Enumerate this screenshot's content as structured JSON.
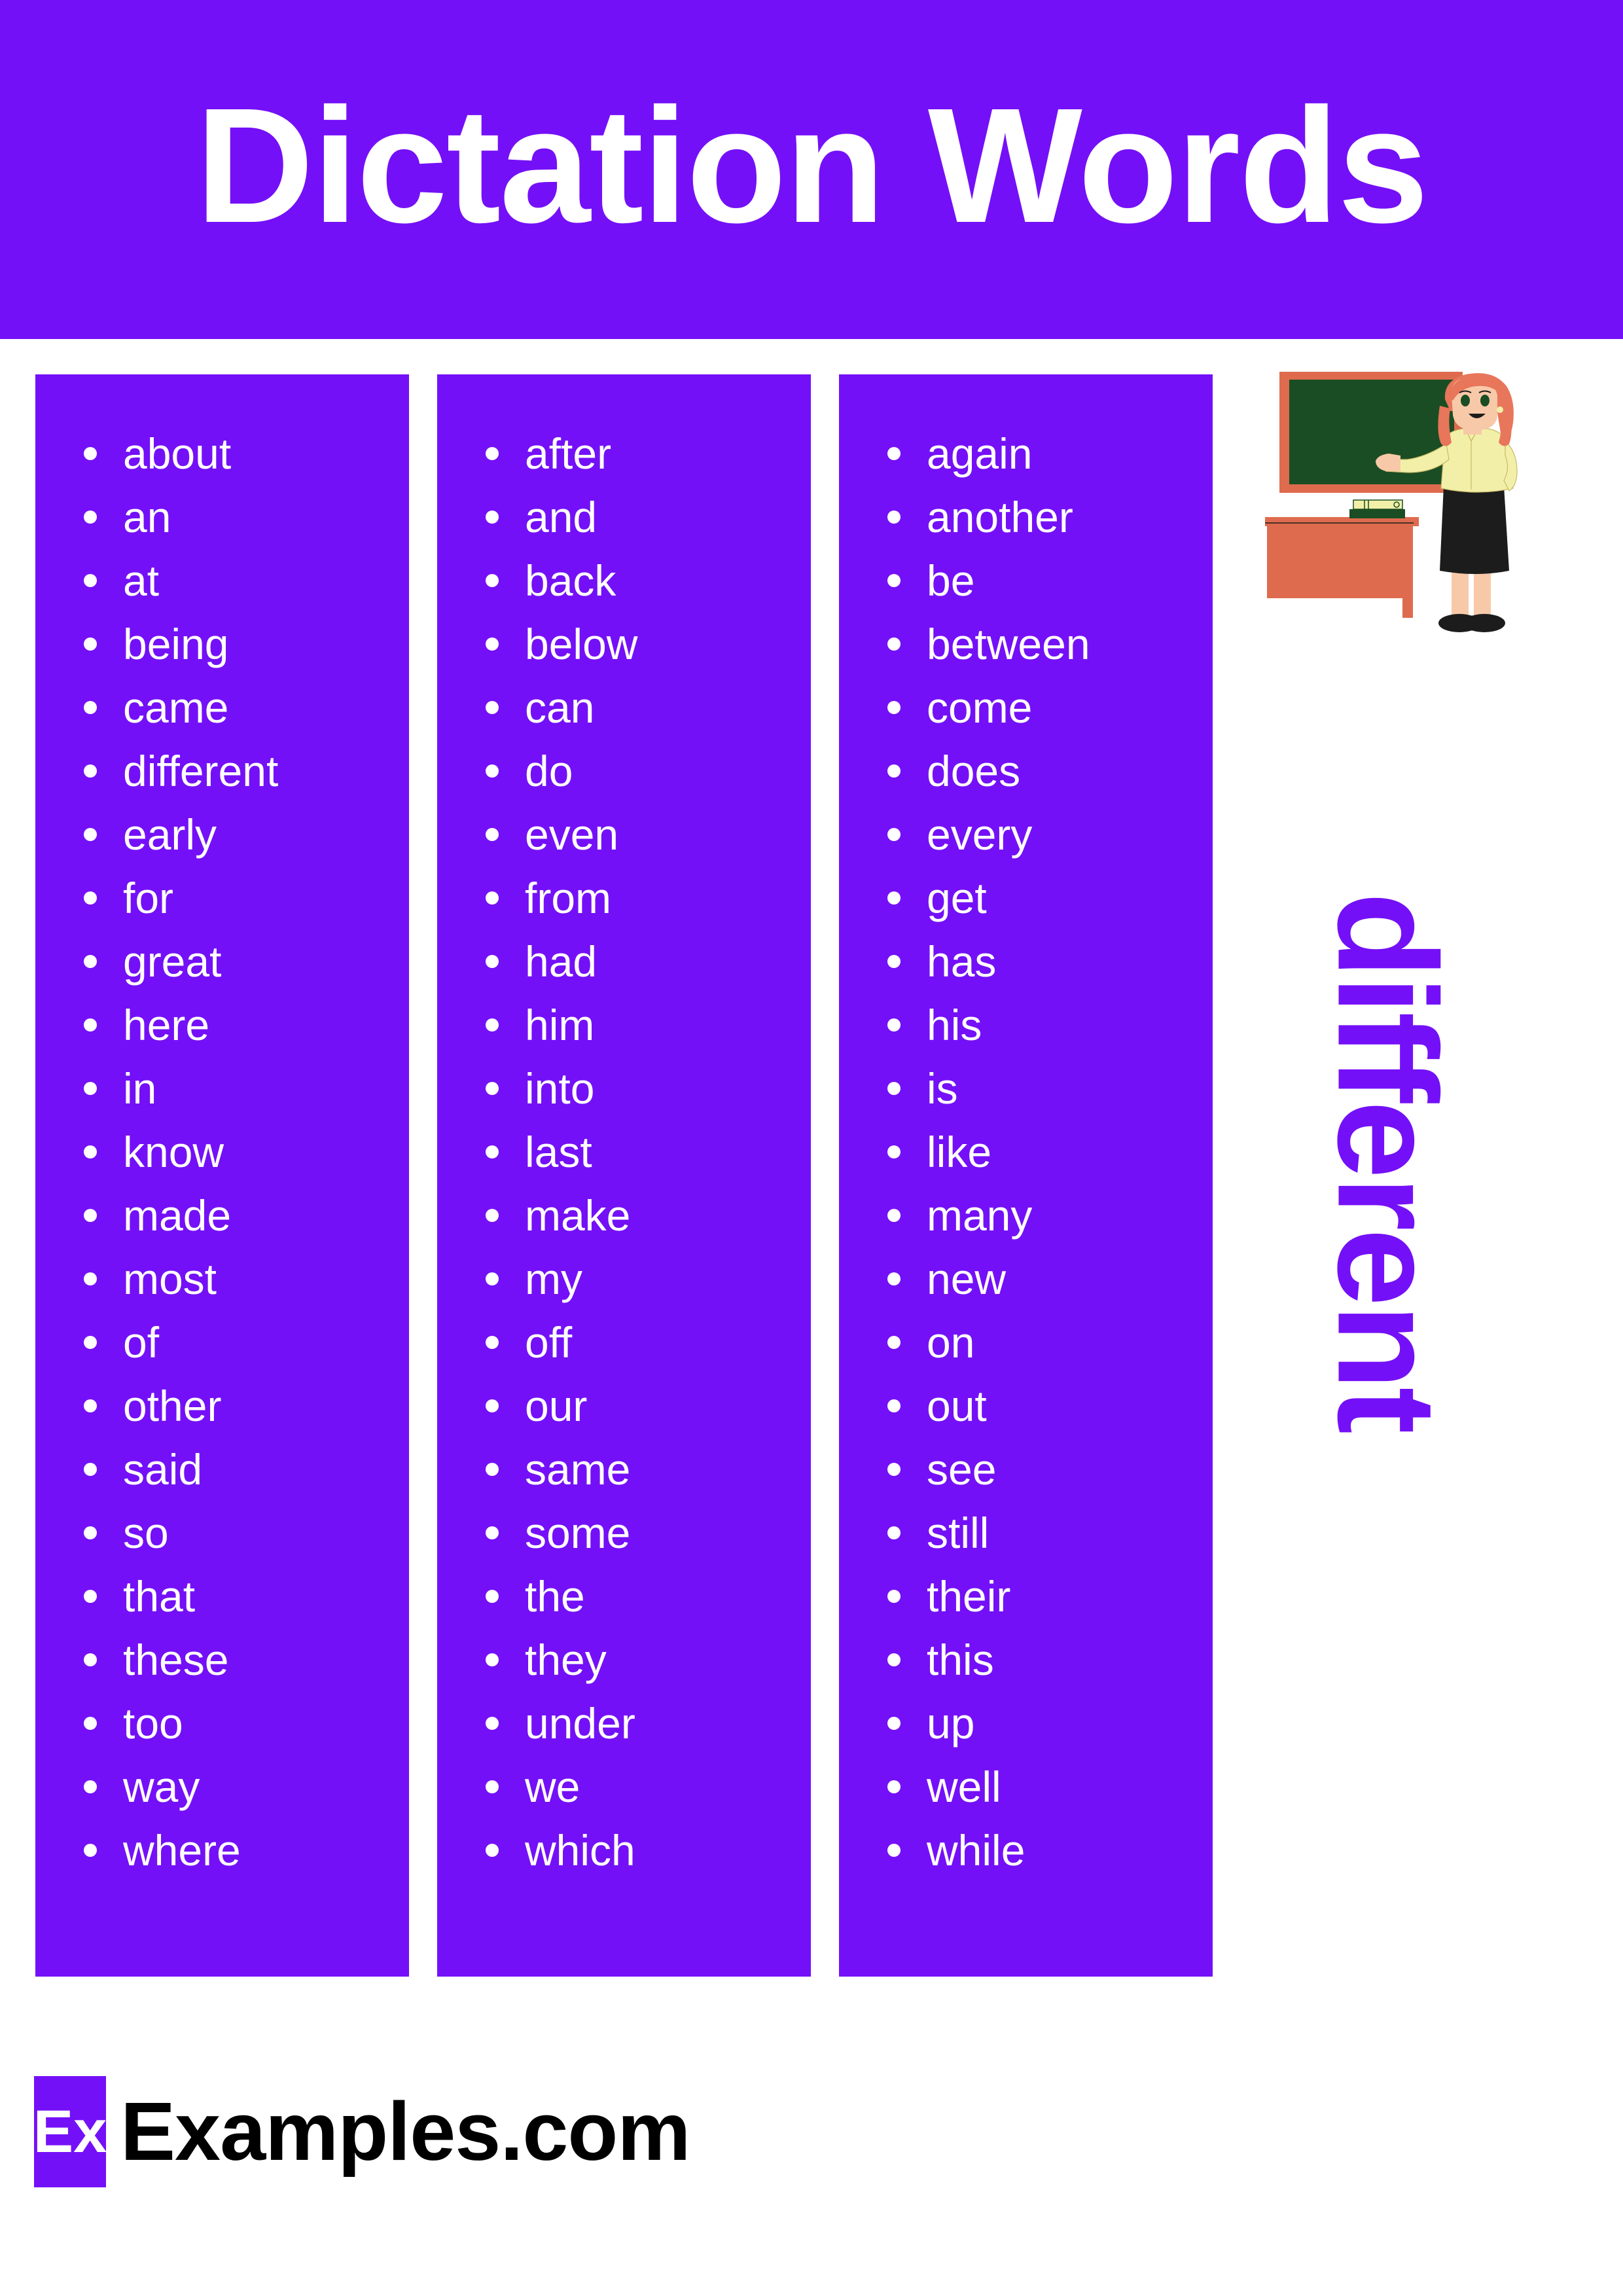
{
  "header": {
    "title": "Dictation Words",
    "background_color": "#7410F7",
    "text_color": "#FFFFFF"
  },
  "columns": [
    {
      "id": "column-1",
      "words": [
        "about",
        "an",
        "at",
        "being",
        "came",
        "different",
        "early",
        "for",
        "great",
        "here",
        "in",
        "know",
        "made",
        "most",
        "of",
        "other",
        "said",
        "so",
        "that",
        "these",
        "too",
        "way",
        "where"
      ]
    },
    {
      "id": "column-2",
      "words": [
        "after",
        "and",
        "back",
        "below",
        "can",
        "do",
        "even",
        "from",
        "had",
        "him",
        "into",
        "last",
        "make",
        "my",
        "off",
        "our",
        "same",
        "some",
        "the",
        "they",
        "under",
        "we",
        "which"
      ]
    },
    {
      "id": "column-3",
      "words": [
        "again",
        "another",
        "be",
        "between",
        "come",
        "does",
        "every",
        "get",
        "has",
        "his",
        "is",
        "like",
        "many",
        "new",
        "on",
        "out",
        "see",
        "still",
        "their",
        "this",
        "up",
        "well",
        "while"
      ]
    }
  ],
  "highlight": {
    "word": "different",
    "color": "#7410F7",
    "orientation": "vertical"
  },
  "illustration": {
    "name": "teacher-at-chalkboard-illustration",
    "chalkboard_color": "#1B4D24",
    "frame_color": "#DF6B4E",
    "desk_color": "#DF6B4E",
    "hair_color": "#E8765A",
    "blouse_color": "#F2F0A8",
    "skirt_color": "#1C1C1C",
    "skin_color": "#F8C9A8"
  },
  "footer": {
    "logo_mark": "Ex",
    "brand": "Examples.com",
    "mark_background": "#7410F7",
    "brand_color": "#000000"
  }
}
